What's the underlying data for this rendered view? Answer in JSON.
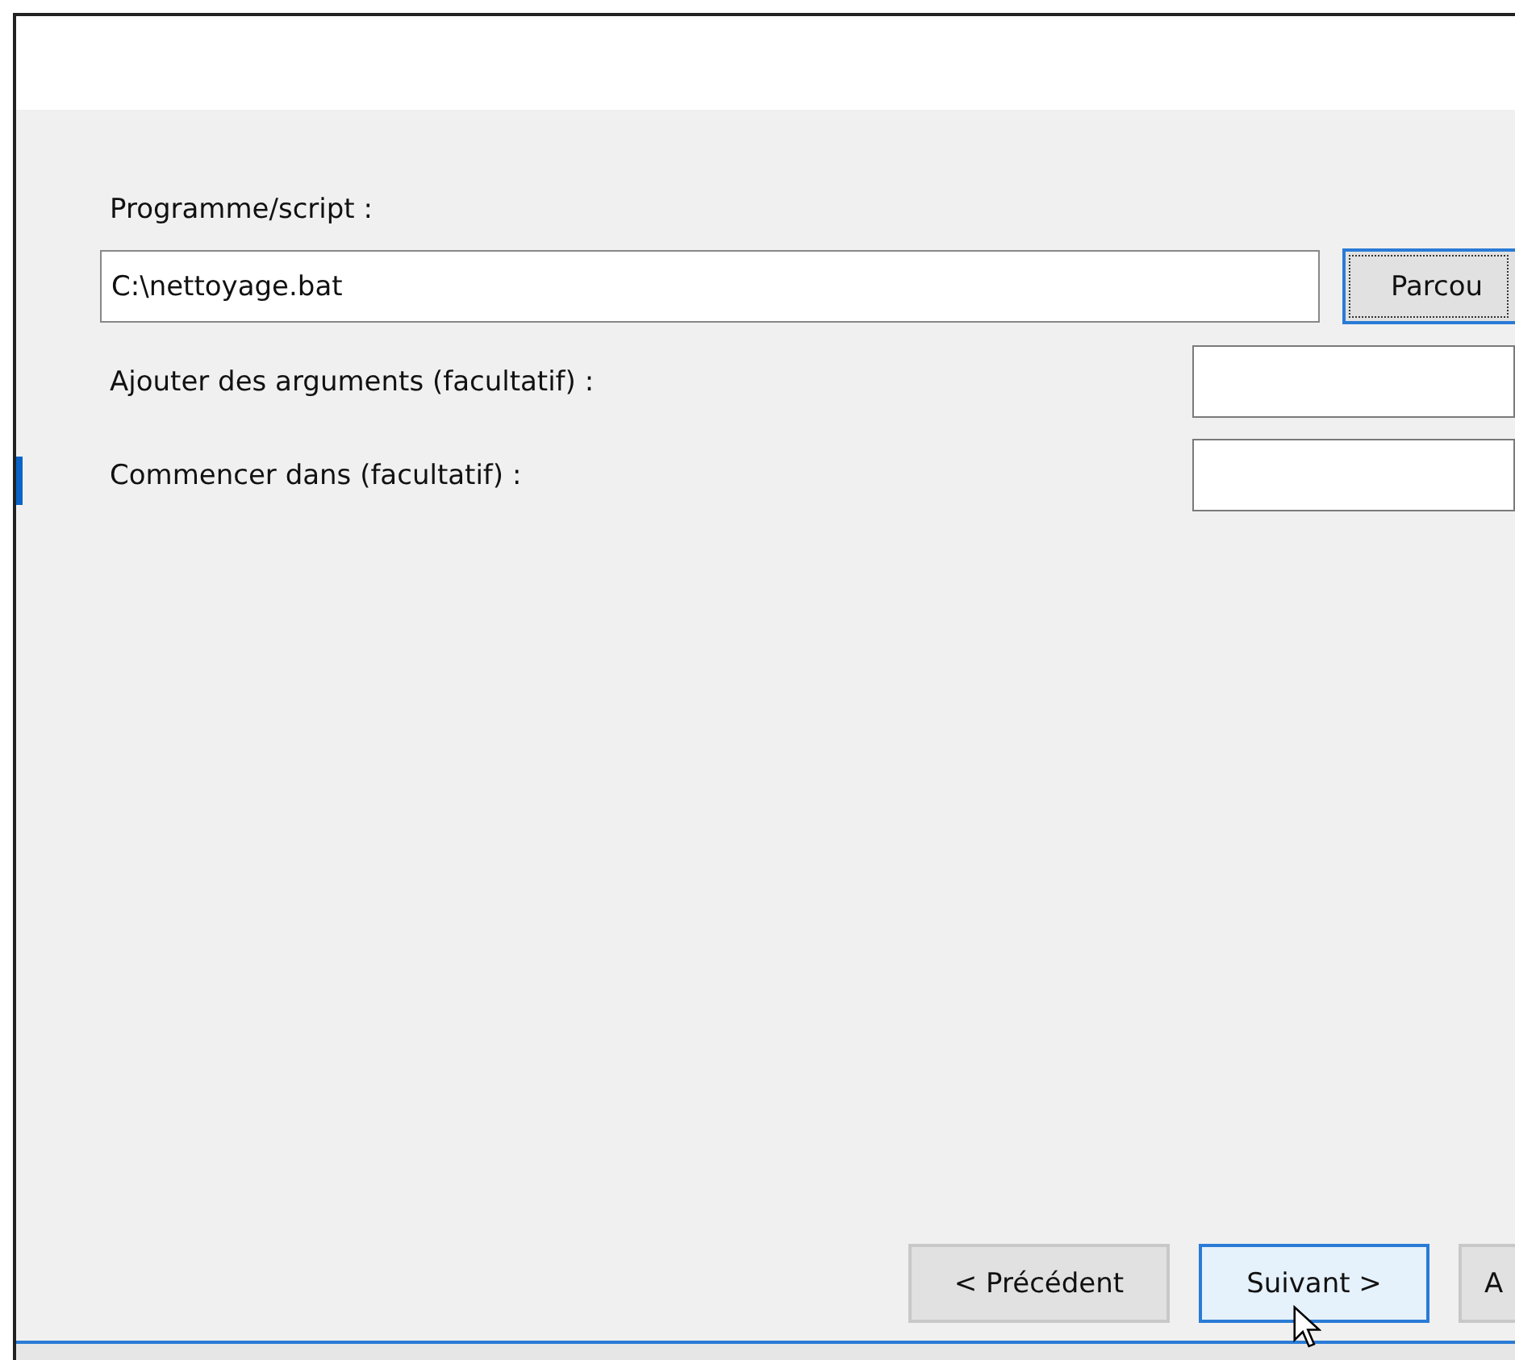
{
  "program": {
    "label": "Programme/script :",
    "value": "C:\\nettoyage.bat",
    "browse_button": "Parcou"
  },
  "arguments": {
    "label": "Ajouter des arguments (facultatif) :"
  },
  "start_in": {
    "label": "Commencer dans (facultatif) :"
  },
  "buttons": [
    {
      "label": "< Précédent",
      "focused": false
    },
    {
      "label": "Suivant >",
      "focused": true
    },
    {
      "label": "A",
      "focused": false
    }
  ]
}
